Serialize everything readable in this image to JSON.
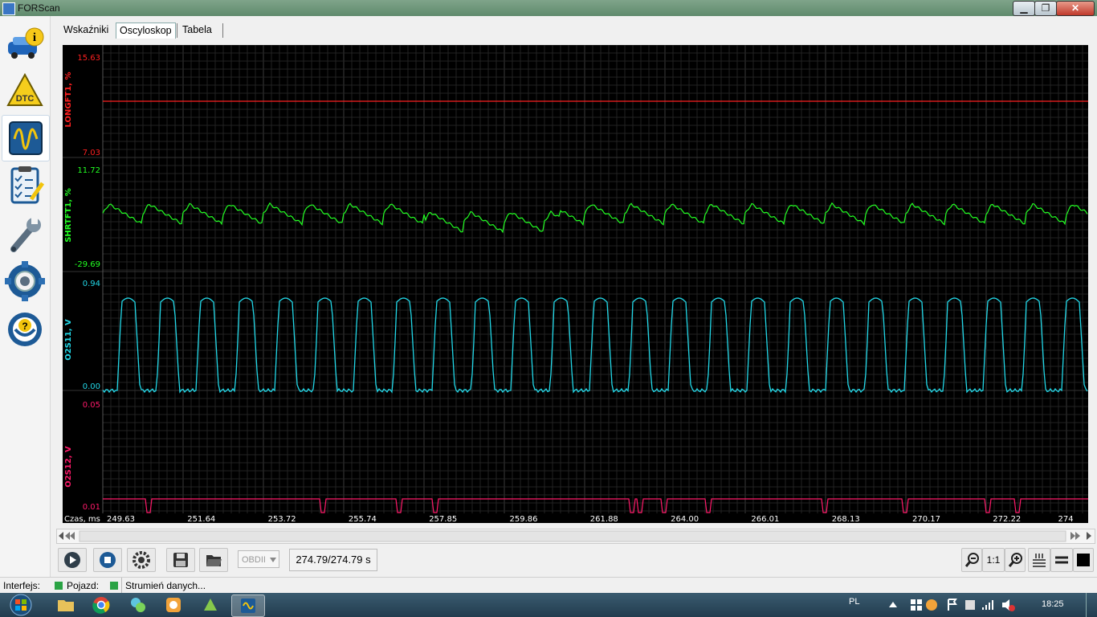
{
  "window": {
    "title": "FORScan",
    "min_glyph": "▁",
    "max_glyph": "❐",
    "close_glyph": "✕"
  },
  "sidebar": {
    "items": [
      {
        "name": "vehicle-info",
        "icon": "car-info-icon"
      },
      {
        "name": "dtc",
        "icon": "dtc-warning-icon",
        "text": "DTC"
      },
      {
        "name": "oscilloscope",
        "icon": "oscilloscope-icon",
        "active": true
      },
      {
        "name": "checklist",
        "icon": "checklist-icon"
      },
      {
        "name": "service",
        "icon": "wrench-icon"
      },
      {
        "name": "settings",
        "icon": "gear-icon"
      },
      {
        "name": "help",
        "icon": "help-icon"
      }
    ]
  },
  "tabs": [
    {
      "label": "Wskaźniki",
      "selected": false
    },
    {
      "label": "Oscyloskop",
      "selected": true
    },
    {
      "label": "Tabela",
      "selected": false
    }
  ],
  "scope": {
    "colors": {
      "grid": "#2a2a2a",
      "longft": "#ff2020",
      "shrtft": "#22ff22",
      "o2s11": "#22d8e8",
      "o2s12": "#ff1a6a",
      "axis_text": "#ffffff"
    },
    "channels": [
      {
        "label": "LONGFT1, %",
        "max": "15.63",
        "min": "7.03"
      },
      {
        "label": "SHRTFT1, %",
        "max": "11.72",
        "min": "-29.69"
      },
      {
        "label": "O2S11, V",
        "max": "0.94",
        "min": "0.00"
      },
      {
        "label": "O2S12, V",
        "max": "0.05",
        "min": "0.01"
      }
    ],
    "time_axis_label": "Czas, ms",
    "time_ticks": [
      "249.63",
      "251.64",
      "253.72",
      "255.74",
      "257.85",
      "259.86",
      "261.88",
      "264.00",
      "266.01",
      "268.13",
      "270.17",
      "272.22",
      "274"
    ]
  },
  "toolbar": {
    "obd_select": "OBDII",
    "time_readout": "274.79/274.79 s",
    "zoom_ratio": "1:1"
  },
  "status": {
    "interface_label": "Interfejs:",
    "vehicle_label": "Pojazd:",
    "stream_label": "Strumień danych..."
  },
  "taskbar": {
    "lang": "PL",
    "clock": "18:25"
  }
}
